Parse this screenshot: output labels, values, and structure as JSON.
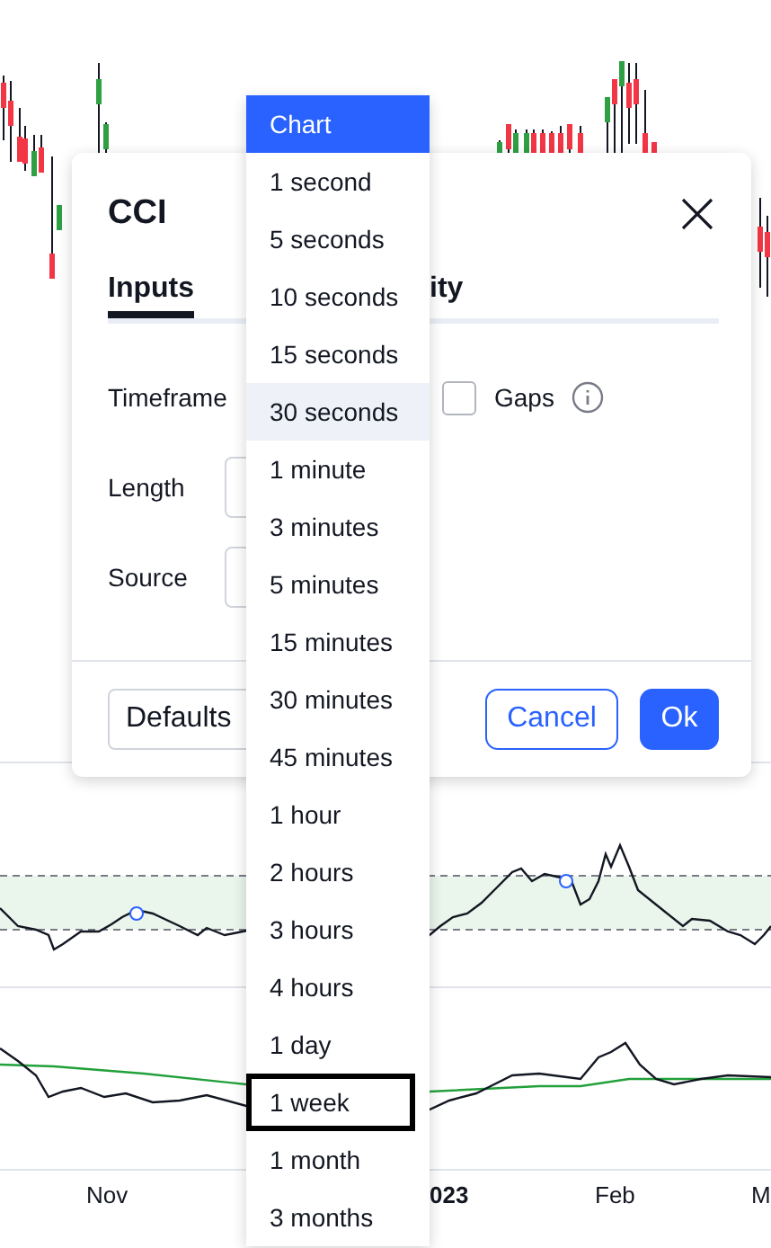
{
  "dialog": {
    "title": "CCI",
    "tabs": [
      {
        "label": "Inputs",
        "selected": true
      },
      {
        "label": "ity",
        "selected": false
      }
    ],
    "fields": [
      {
        "label": "Timeframe",
        "kind": "timeframe"
      },
      {
        "label": "Length",
        "kind": "text"
      },
      {
        "label": "Source",
        "kind": "text"
      }
    ],
    "gaps": {
      "label": "Gaps",
      "checked": false
    },
    "buttons": {
      "defaults": "Defaults",
      "cancel": "Cancel",
      "ok": "Ok"
    }
  },
  "dropdown": [
    {
      "label": "Chart",
      "selected": true,
      "highlighted": false,
      "focused": false
    },
    {
      "label": "1 second",
      "selected": false,
      "highlighted": false,
      "focused": false
    },
    {
      "label": "5 seconds",
      "selected": false,
      "highlighted": false,
      "focused": false
    },
    {
      "label": "10 seconds",
      "selected": false,
      "highlighted": false,
      "focused": false
    },
    {
      "label": "15 seconds",
      "selected": false,
      "highlighted": false,
      "focused": false
    },
    {
      "label": "30 seconds",
      "selected": false,
      "highlighted": true,
      "focused": false
    },
    {
      "label": "1 minute",
      "selected": false,
      "highlighted": false,
      "focused": false
    },
    {
      "label": "3 minutes",
      "selected": false,
      "highlighted": false,
      "focused": false
    },
    {
      "label": "5 minutes",
      "selected": false,
      "highlighted": false,
      "focused": false
    },
    {
      "label": "15 minutes",
      "selected": false,
      "highlighted": false,
      "focused": false
    },
    {
      "label": "30 minutes",
      "selected": false,
      "highlighted": false,
      "focused": false
    },
    {
      "label": "45 minutes",
      "selected": false,
      "highlighted": false,
      "focused": false
    },
    {
      "label": "1 hour",
      "selected": false,
      "highlighted": false,
      "focused": false
    },
    {
      "label": "2 hours",
      "selected": false,
      "highlighted": false,
      "focused": false
    },
    {
      "label": "3 hours",
      "selected": false,
      "highlighted": false,
      "focused": false
    },
    {
      "label": "4 hours",
      "selected": false,
      "highlighted": false,
      "focused": false
    },
    {
      "label": "1 day",
      "selected": false,
      "highlighted": false,
      "focused": false
    },
    {
      "label": "1 week",
      "selected": false,
      "highlighted": false,
      "focused": true
    },
    {
      "label": "1 month",
      "selected": false,
      "highlighted": false,
      "focused": false
    },
    {
      "label": "3 months",
      "selected": false,
      "highlighted": false,
      "focused": false
    }
  ],
  "time_axis": [
    {
      "label": "Nov",
      "bold": false
    },
    {
      "label": "023",
      "bold": true
    },
    {
      "label": "Feb",
      "bold": false
    },
    {
      "label": "M",
      "bold": false
    }
  ]
}
